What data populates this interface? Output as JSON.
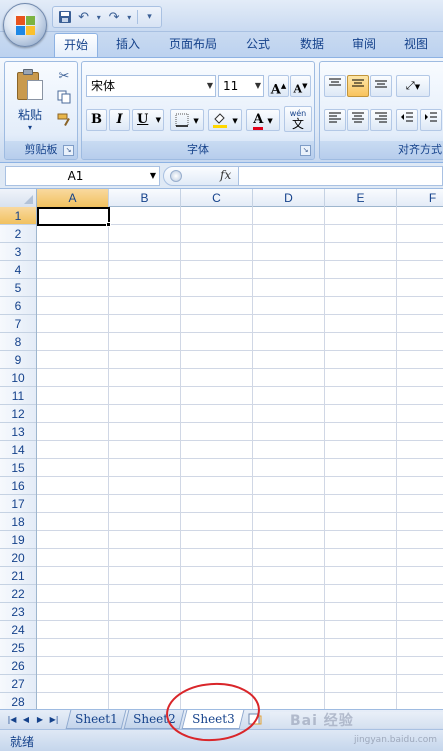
{
  "tabs": [
    {
      "label": "开始",
      "active": true
    },
    {
      "label": "插入",
      "active": false
    },
    {
      "label": "页面布局",
      "active": false
    },
    {
      "label": "公式",
      "active": false
    },
    {
      "label": "数据",
      "active": false
    },
    {
      "label": "审阅",
      "active": false
    },
    {
      "label": "视图",
      "active": false
    }
  ],
  "clipboard": {
    "paste_label": "粘贴",
    "group_label": "剪贴板"
  },
  "font": {
    "name": "宋体",
    "size": "11",
    "group_label": "字体",
    "bold_label": "B",
    "italic_label": "I",
    "underline_label": "U",
    "grow_label": "A",
    "shrink_label": "A",
    "wen_label": "wén",
    "wen_char": "文",
    "font_color": "#e0001a",
    "fill_color": "#ffd700"
  },
  "alignment": {
    "group_label": "对齐方式"
  },
  "formula_bar": {
    "name_box": "A1",
    "fx_label": "fx",
    "formula": ""
  },
  "grid": {
    "columns": [
      "A",
      "B",
      "C",
      "D",
      "E",
      "F"
    ],
    "rows": [
      "1",
      "2",
      "3",
      "4",
      "5",
      "6",
      "7",
      "8",
      "9",
      "10",
      "11",
      "12",
      "13",
      "14",
      "15",
      "16",
      "17",
      "18",
      "19",
      "20",
      "21",
      "22",
      "23",
      "24",
      "25",
      "26",
      "27",
      "28"
    ],
    "selected_cell": "A1"
  },
  "sheets": [
    {
      "name": "Sheet1",
      "active": false
    },
    {
      "name": "Sheet2",
      "active": false
    },
    {
      "name": "Sheet3",
      "active": true
    }
  ],
  "status": {
    "text": "就绪"
  },
  "watermark": {
    "brand": "Bai 经验",
    "url": "jingyan.baidu.com"
  },
  "colors": {
    "ribbon_text": "#15428b",
    "annotation": "#d9262a",
    "selection": "#f1c15f"
  }
}
